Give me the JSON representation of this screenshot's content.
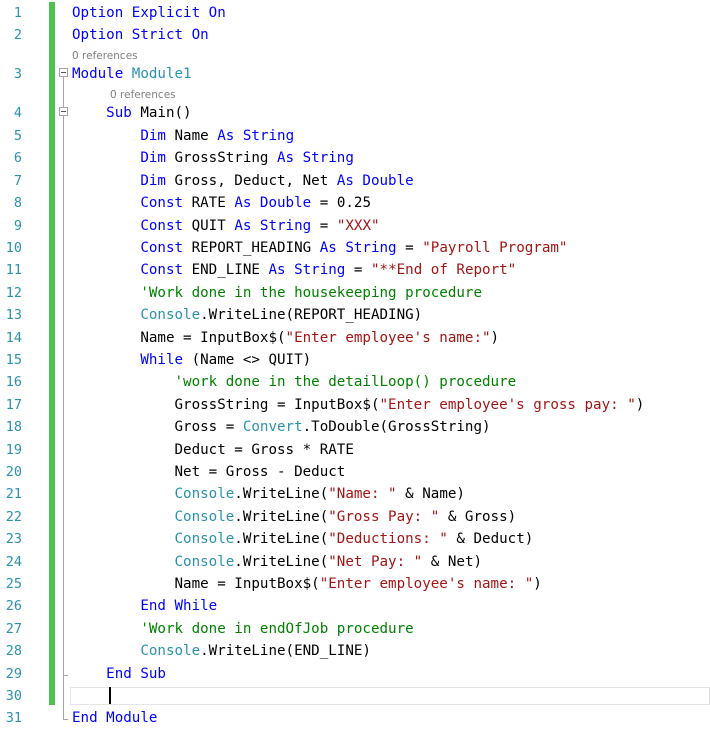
{
  "editor": {
    "language": "Visual Basic",
    "codelens_text": "0 references",
    "lines": [
      {
        "n": "1",
        "tokens": [
          [
            "kw",
            "Option Explicit On"
          ]
        ]
      },
      {
        "n": "2",
        "tokens": [
          [
            "kw",
            "Option Strict On"
          ]
        ]
      },
      {
        "n": "3",
        "tokens": [
          [
            "kw",
            "Module "
          ],
          [
            "ty",
            "Module1"
          ]
        ]
      },
      {
        "n": "4",
        "tokens": [
          [
            "pl",
            "    "
          ],
          [
            "kw",
            "Sub "
          ],
          [
            "pl",
            "Main()"
          ]
        ]
      },
      {
        "n": "5",
        "tokens": [
          [
            "pl",
            "        "
          ],
          [
            "kw",
            "Dim "
          ],
          [
            "pl",
            "Name "
          ],
          [
            "kw",
            "As String"
          ]
        ]
      },
      {
        "n": "6",
        "tokens": [
          [
            "pl",
            "        "
          ],
          [
            "kw",
            "Dim "
          ],
          [
            "pl",
            "GrossString "
          ],
          [
            "kw",
            "As String"
          ]
        ]
      },
      {
        "n": "7",
        "tokens": [
          [
            "pl",
            "        "
          ],
          [
            "kw",
            "Dim "
          ],
          [
            "pl",
            "Gross, Deduct, Net "
          ],
          [
            "kw",
            "As Double"
          ]
        ]
      },
      {
        "n": "8",
        "tokens": [
          [
            "pl",
            "        "
          ],
          [
            "kw",
            "Const "
          ],
          [
            "pl",
            "RATE "
          ],
          [
            "kw",
            "As Double "
          ],
          [
            "pl",
            "= 0.25"
          ]
        ]
      },
      {
        "n": "9",
        "tokens": [
          [
            "pl",
            "        "
          ],
          [
            "kw",
            "Const "
          ],
          [
            "pl",
            "QUIT "
          ],
          [
            "kw",
            "As String "
          ],
          [
            "pl",
            "= "
          ],
          [
            "str",
            "\"XXX\""
          ]
        ]
      },
      {
        "n": "10",
        "tokens": [
          [
            "pl",
            "        "
          ],
          [
            "kw",
            "Const "
          ],
          [
            "pl",
            "REPORT_HEADING "
          ],
          [
            "kw",
            "As String "
          ],
          [
            "pl",
            "= "
          ],
          [
            "str",
            "\"Payroll Program\""
          ]
        ]
      },
      {
        "n": "11",
        "tokens": [
          [
            "pl",
            "        "
          ],
          [
            "kw",
            "Const "
          ],
          [
            "pl",
            "END_LINE "
          ],
          [
            "kw",
            "As String "
          ],
          [
            "pl",
            "= "
          ],
          [
            "str",
            "\"**End of Report\""
          ]
        ]
      },
      {
        "n": "12",
        "tokens": [
          [
            "pl",
            "        "
          ],
          [
            "cm",
            "'Work done in the housekeeping procedure"
          ]
        ]
      },
      {
        "n": "13",
        "tokens": [
          [
            "pl",
            "        "
          ],
          [
            "ty",
            "Console"
          ],
          [
            "pl",
            ".WriteLine(REPORT_HEADING)"
          ]
        ]
      },
      {
        "n": "14",
        "tokens": [
          [
            "pl",
            "        Name = InputBox$("
          ],
          [
            "str",
            "\"Enter employee's name:\""
          ],
          [
            "pl",
            ")"
          ]
        ]
      },
      {
        "n": "15",
        "tokens": [
          [
            "pl",
            "        "
          ],
          [
            "kw",
            "While "
          ],
          [
            "pl",
            "(Name <> QUIT)"
          ]
        ]
      },
      {
        "n": "16",
        "tokens": [
          [
            "pl",
            "            "
          ],
          [
            "cm",
            "'work done in the detailLoop() procedure"
          ]
        ]
      },
      {
        "n": "17",
        "tokens": [
          [
            "pl",
            "            GrossString = InputBox$("
          ],
          [
            "str",
            "\"Enter employee's gross pay: \""
          ],
          [
            "pl",
            ")"
          ]
        ]
      },
      {
        "n": "18",
        "tokens": [
          [
            "pl",
            "            Gross = "
          ],
          [
            "ty",
            "Convert"
          ],
          [
            "pl",
            ".ToDouble(GrossString)"
          ]
        ]
      },
      {
        "n": "19",
        "tokens": [
          [
            "pl",
            "            Deduct = Gross * RATE"
          ]
        ]
      },
      {
        "n": "20",
        "tokens": [
          [
            "pl",
            "            Net = Gross - Deduct"
          ]
        ]
      },
      {
        "n": "21",
        "tokens": [
          [
            "pl",
            "            "
          ],
          [
            "ty",
            "Console"
          ],
          [
            "pl",
            ".WriteLine("
          ],
          [
            "str",
            "\"Name: \""
          ],
          [
            "pl",
            " & Name)"
          ]
        ]
      },
      {
        "n": "22",
        "tokens": [
          [
            "pl",
            "            "
          ],
          [
            "ty",
            "Console"
          ],
          [
            "pl",
            ".WriteLine("
          ],
          [
            "str",
            "\"Gross Pay: \""
          ],
          [
            "pl",
            " & Gross)"
          ]
        ]
      },
      {
        "n": "23",
        "tokens": [
          [
            "pl",
            "            "
          ],
          [
            "ty",
            "Console"
          ],
          [
            "pl",
            ".WriteLine("
          ],
          [
            "str",
            "\"Deductions: \""
          ],
          [
            "pl",
            " & Deduct)"
          ]
        ]
      },
      {
        "n": "24",
        "tokens": [
          [
            "pl",
            "            "
          ],
          [
            "ty",
            "Console"
          ],
          [
            "pl",
            ".WriteLine("
          ],
          [
            "str",
            "\"Net Pay: \""
          ],
          [
            "pl",
            " & Net)"
          ]
        ]
      },
      {
        "n": "25",
        "tokens": [
          [
            "pl",
            "            Name = InputBox$("
          ],
          [
            "str",
            "\"Enter employee's name: \""
          ],
          [
            "pl",
            ")"
          ]
        ]
      },
      {
        "n": "26",
        "tokens": [
          [
            "pl",
            "        "
          ],
          [
            "kw",
            "End While"
          ]
        ]
      },
      {
        "n": "27",
        "tokens": [
          [
            "pl",
            "        "
          ],
          [
            "cm",
            "'Work done in endOfJob procedure"
          ]
        ]
      },
      {
        "n": "28",
        "tokens": [
          [
            "pl",
            "        "
          ],
          [
            "ty",
            "Console"
          ],
          [
            "pl",
            ".WriteLine(END_LINE)"
          ]
        ]
      },
      {
        "n": "29",
        "tokens": [
          [
            "pl",
            "    "
          ],
          [
            "kw",
            "End Sub"
          ]
        ]
      },
      {
        "n": "30",
        "tokens": []
      },
      {
        "n": "31",
        "tokens": [
          [
            "kw",
            "End Module"
          ]
        ]
      }
    ],
    "colors": {
      "keyword": "#0000ff",
      "type": "#2b91af",
      "string": "#a31515",
      "comment": "#008000",
      "line_number": "#2b91af",
      "change_bar": "#4ec24e"
    }
  }
}
